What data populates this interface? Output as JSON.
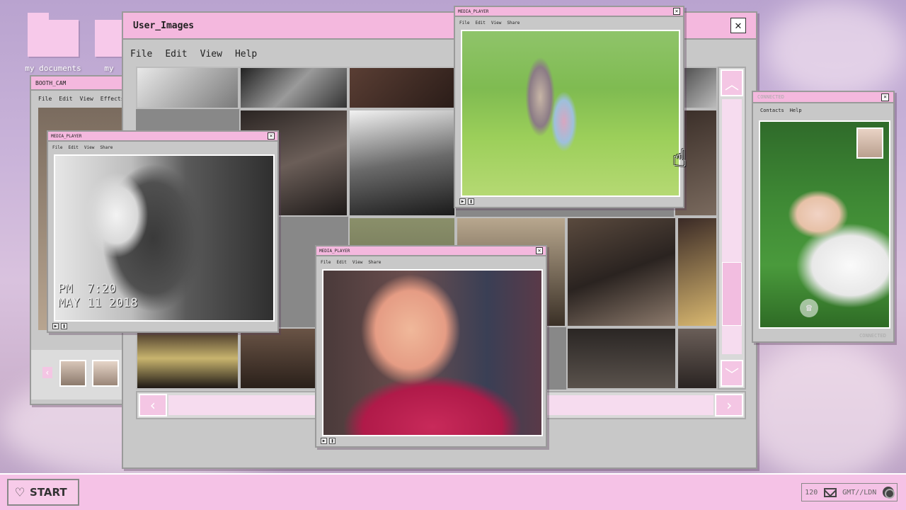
{
  "desktop": {
    "icons": [
      {
        "label": "my documents"
      },
      {
        "label": "my"
      }
    ]
  },
  "main_window": {
    "title": "User_Images",
    "close_label": "✕",
    "menu": [
      "File",
      "Edit",
      "View",
      "Help"
    ]
  },
  "booth_window": {
    "title": "BOOTH_CAM",
    "menu": [
      "File",
      "Edit",
      "View",
      "Effects"
    ],
    "prev_label": "‹"
  },
  "media_player_left": {
    "title": "MEDIA_PLAYER",
    "menu": [
      "File",
      "Edit",
      "View",
      "Share"
    ],
    "osd_time": "PM  7:20",
    "osd_date": "MAY 11 2018"
  },
  "media_player_top": {
    "title": "MEDIA_PLAYER",
    "menu": [
      "File",
      "Edit",
      "View",
      "Share"
    ]
  },
  "media_player_center": {
    "title": "MEDIA_PLAYER",
    "menu": [
      "File",
      "Edit",
      "View",
      "Share"
    ]
  },
  "right_window": {
    "title": "CONNECTED",
    "menu": [
      "Contacts",
      "Help"
    ],
    "footer": "CONNECTED"
  },
  "taskbar": {
    "start_label": "START",
    "tray_count": "120",
    "tray_timezone": "GMT//LDN"
  },
  "colors": {
    "accent_pink": "#f4b8de",
    "window_gray": "#c8c8c8"
  }
}
